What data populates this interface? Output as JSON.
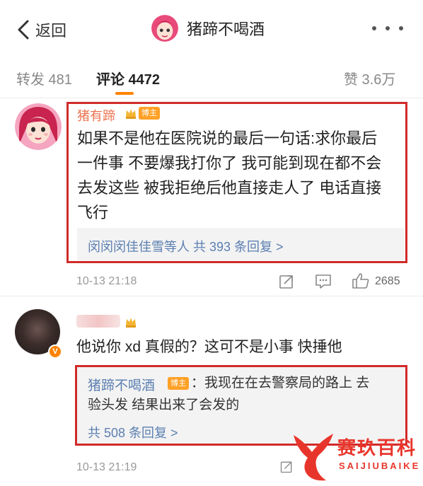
{
  "nav": {
    "back_label": "返回",
    "title": "猪蹄不喝酒"
  },
  "tabs": [
    {
      "label": "转发 481"
    },
    {
      "label": "评论 4472",
      "active": true
    },
    {
      "label": "赞 3.6万"
    }
  ],
  "comments": [
    {
      "author": "猪有蹄",
      "badge": "博主",
      "lines": [
        "如果不是他在医院说的最后一句话:求你最后",
        "一件事 不要爆我打你了 我可能到现在都不会",
        "去发这些 被我拒绝后他直接走人了 电话直接",
        "飞行"
      ],
      "replies_summary": "闵闵闵佳佳雪等人  共 393 条回复 >",
      "time": "10-13 21:18",
      "likes": "2685"
    },
    {
      "author": "",
      "text": "他说你 xd 真假的？这可不是小事 快捶他",
      "reply": {
        "author": "猪蹄不喝酒",
        "badge": "博主",
        "text_line1": "：我现在在去警察局的路上 去",
        "text_line2": "验头发 结果出来了会发的",
        "more": "共 508 条回复 >"
      },
      "time": "10-13 21:19"
    }
  ],
  "watermark": {
    "title": "赛玖百科",
    "subtitle": "SAIJIUBAIKE"
  },
  "colors": {
    "accent": "#ff8200",
    "name": "#eb7350",
    "link": "#5b7fb1",
    "highlight_box": "#d12a2a"
  }
}
